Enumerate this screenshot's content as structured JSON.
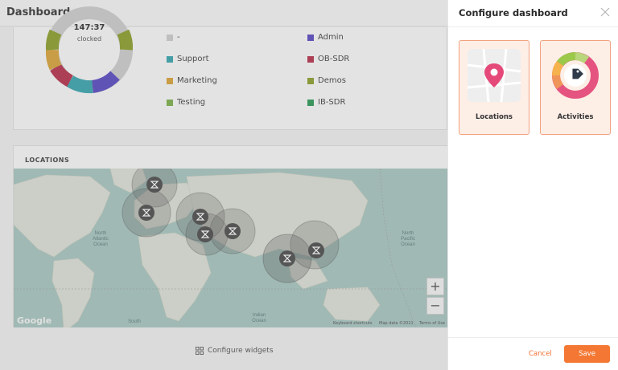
{
  "dashboard": {
    "title": "Dashboard",
    "donut": {
      "value": "147:37",
      "label": "clocked"
    },
    "legend": [
      {
        "label": "-",
        "color": "#cfcfcf"
      },
      {
        "label": "Admin",
        "color": "#5b4bc4"
      },
      {
        "label": "Support",
        "color": "#3aa6b0"
      },
      {
        "label": "OB-SDR",
        "color": "#b8334f"
      },
      {
        "label": "Marketing",
        "color": "#d9a53b"
      },
      {
        "label": "Demos",
        "color": "#8ea02d"
      },
      {
        "label": "Testing",
        "color": "#7db14b"
      },
      {
        "label": "IB-SDR",
        "color": "#2f9a5a"
      }
    ],
    "locations_header": "LOCATIONS",
    "map": {
      "labels": [
        "North Atlantic Ocean",
        "North Pacific Ocean",
        "Indian Ocean",
        "South"
      ],
      "google": "Google",
      "footer": [
        "Keyboard shortcuts",
        "Map data ©2021",
        "Terms of Use"
      ],
      "zoom_in": "+",
      "zoom_out": "−"
    },
    "configure_widgets": "Configure widgets"
  },
  "panel": {
    "title": "Configure dashboard",
    "widgets": [
      {
        "label": "Locations"
      },
      {
        "label": "Activities"
      }
    ],
    "cancel": "Cancel",
    "save": "Save",
    "accent": "#f47833"
  }
}
